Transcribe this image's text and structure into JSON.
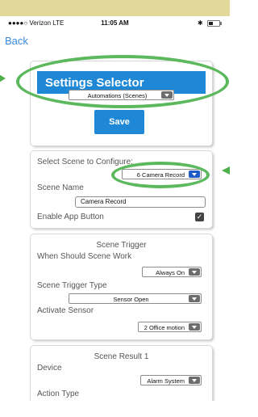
{
  "status_bar": {
    "carrier": "●●●●○ Verizon  LTE",
    "time": "11:05 AM",
    "bluetooth": "✱"
  },
  "nav": {
    "back_label": "Back"
  },
  "settings_selector": {
    "title": "Settings Selector",
    "dropdown_value": "Automations (Scenes)",
    "save_label": "Save"
  },
  "scene_config": {
    "select_scene_label": "Select Scene to Configure:",
    "scene_value": "6 Camera Record",
    "scene_name_label": "Scene Name",
    "scene_name_value": "Camera Record",
    "enable_app_button_label": "Enable App Button",
    "enable_app_button_checked": true,
    "check_glyph": "✓"
  },
  "scene_trigger": {
    "heading": "Scene Trigger",
    "when_label": "When Should Scene Work",
    "when_value": "Always On",
    "type_label": "Scene Trigger Type",
    "type_value": "Sensor Open",
    "sensor_label": "Activate Sensor",
    "sensor_value": "2 Office motion"
  },
  "scene_result": {
    "heading": "Scene Result 1",
    "device_label": "Device",
    "device_value": "Alarm System",
    "action_type_label": "Action Type"
  },
  "colors": {
    "accent_blue": "#1e88d6",
    "highlight_green": "#5cb85c",
    "top_band": "#e2d89a"
  }
}
